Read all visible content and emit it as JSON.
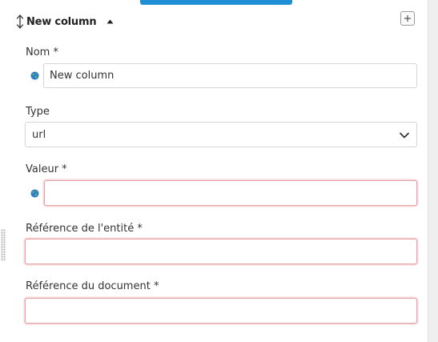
{
  "header": {
    "title": "New column"
  },
  "fields": {
    "nom": {
      "label": "Nom *",
      "value": "New column"
    },
    "type": {
      "label": "Type",
      "selected": "url"
    },
    "valeur": {
      "label": "Valeur *",
      "value": ""
    },
    "reference_entite": {
      "label": "Référence de l'entité *",
      "value": ""
    },
    "reference_document": {
      "label": "Référence du document *",
      "value": ""
    }
  },
  "colors": {
    "accent": "#1f8fd6",
    "invalid_border": "#e6a3a6",
    "border": "#d4d4d4",
    "globe": "#2b7fc2"
  },
  "icons": {
    "reorder": "reorder-arrows-icon",
    "collapse": "caret-up-icon",
    "add": "plus-icon",
    "globe": "globe-icon",
    "chevron": "chevron-down-icon"
  }
}
